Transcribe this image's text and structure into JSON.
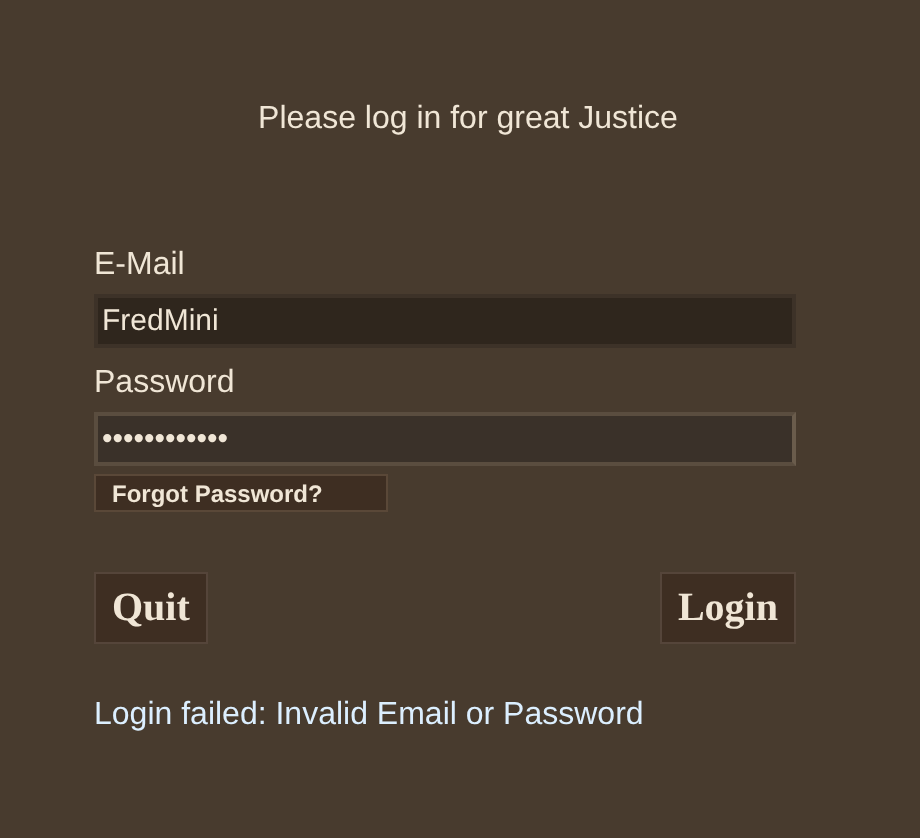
{
  "heading": "Please log in for great Justice",
  "fields": [
    {
      "label": "E-Mail",
      "value": "FredMini",
      "focused": false
    },
    {
      "label": "Password",
      "value": "••••••••••••",
      "focused": true
    }
  ],
  "forgot_link": "Forgot Password?",
  "buttons": [
    "Quit",
    "Login"
  ],
  "error": "Login failed: Invalid Email or Password"
}
